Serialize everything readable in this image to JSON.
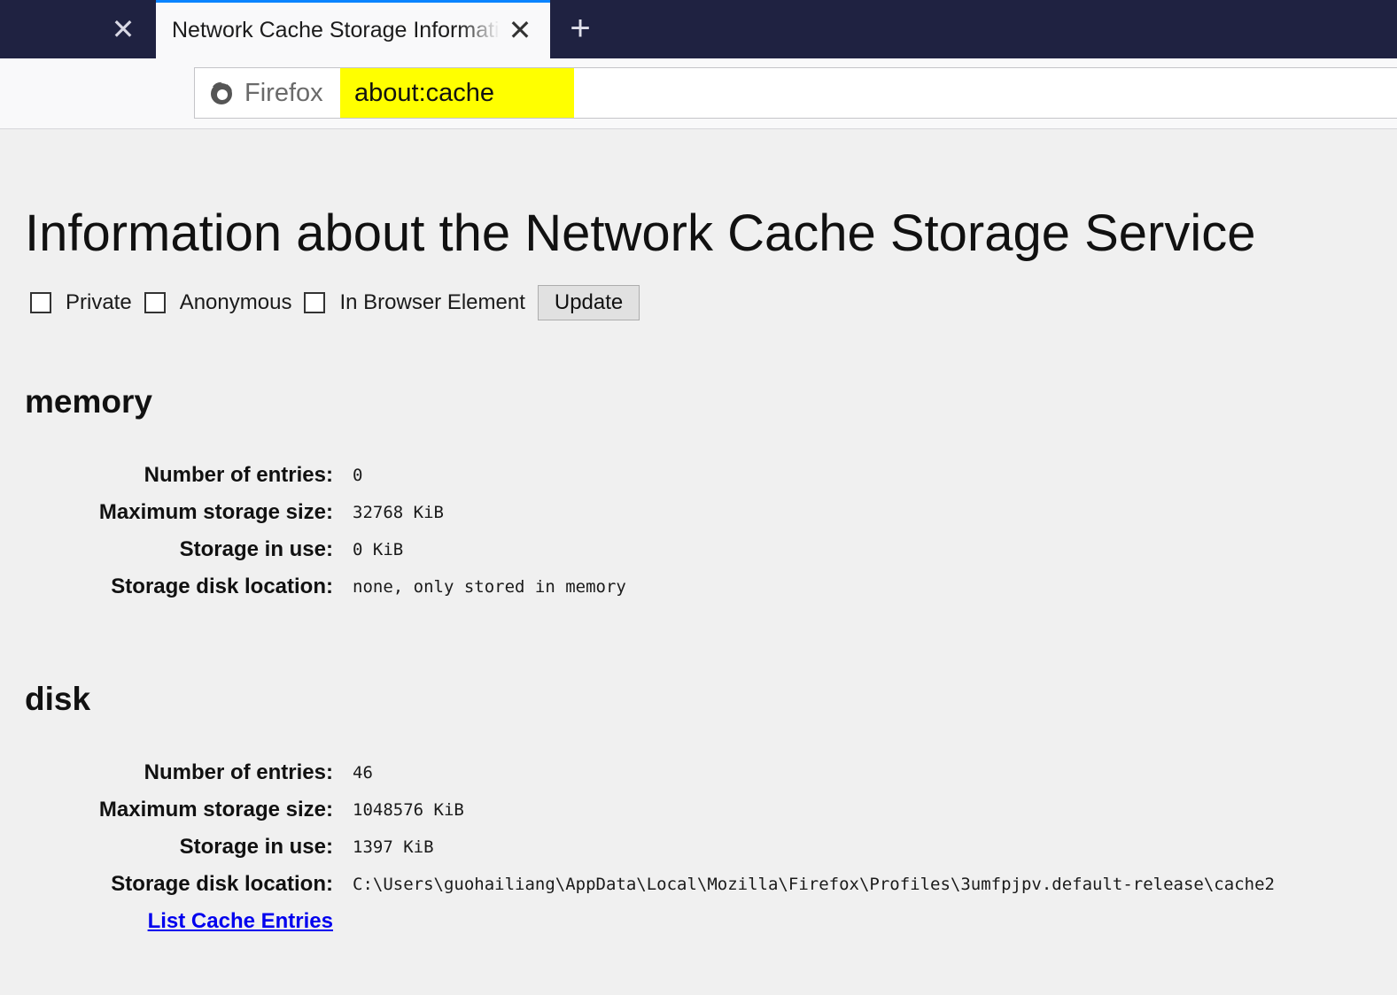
{
  "tabs": {
    "active_title": "Network Cache Storage Information",
    "close_glyph": "✕",
    "new_tab_glyph": "+"
  },
  "urlbar": {
    "identity_label": "Firefox",
    "url": "about:cache",
    "highlight_color": "#ffff00"
  },
  "page": {
    "title": "Information about the Network Cache Storage Service",
    "filters": [
      {
        "label": "Private",
        "checked": false
      },
      {
        "label": "Anonymous",
        "checked": false
      },
      {
        "label": "In Browser Element",
        "checked": false
      }
    ],
    "update_label": "Update"
  },
  "memory": {
    "heading": "memory",
    "rows": [
      {
        "key": "Number of entries:",
        "value": "0"
      },
      {
        "key": "Maximum storage size:",
        "value": "32768 KiB"
      },
      {
        "key": "Storage in use:",
        "value": "0 KiB"
      },
      {
        "key": "Storage disk location:",
        "value": "none, only stored in memory"
      }
    ]
  },
  "disk": {
    "heading": "disk",
    "rows": [
      {
        "key": "Number of entries:",
        "value": "46"
      },
      {
        "key": "Maximum storage size:",
        "value": "1048576 KiB"
      },
      {
        "key": "Storage in use:",
        "value": "1397 KiB"
      },
      {
        "key": "Storage disk location:",
        "value": "C:\\Users\\guohailiang\\AppData\\Local\\Mozilla\\Firefox\\Profiles\\3umfpjpv.default-release\\cache2"
      }
    ],
    "list_link": "List Cache Entries"
  },
  "colors": {
    "tabstrip": "#1f2241",
    "accent": "#0a84ff",
    "link": "#0000ee",
    "page_bg": "#f0f0f0"
  }
}
